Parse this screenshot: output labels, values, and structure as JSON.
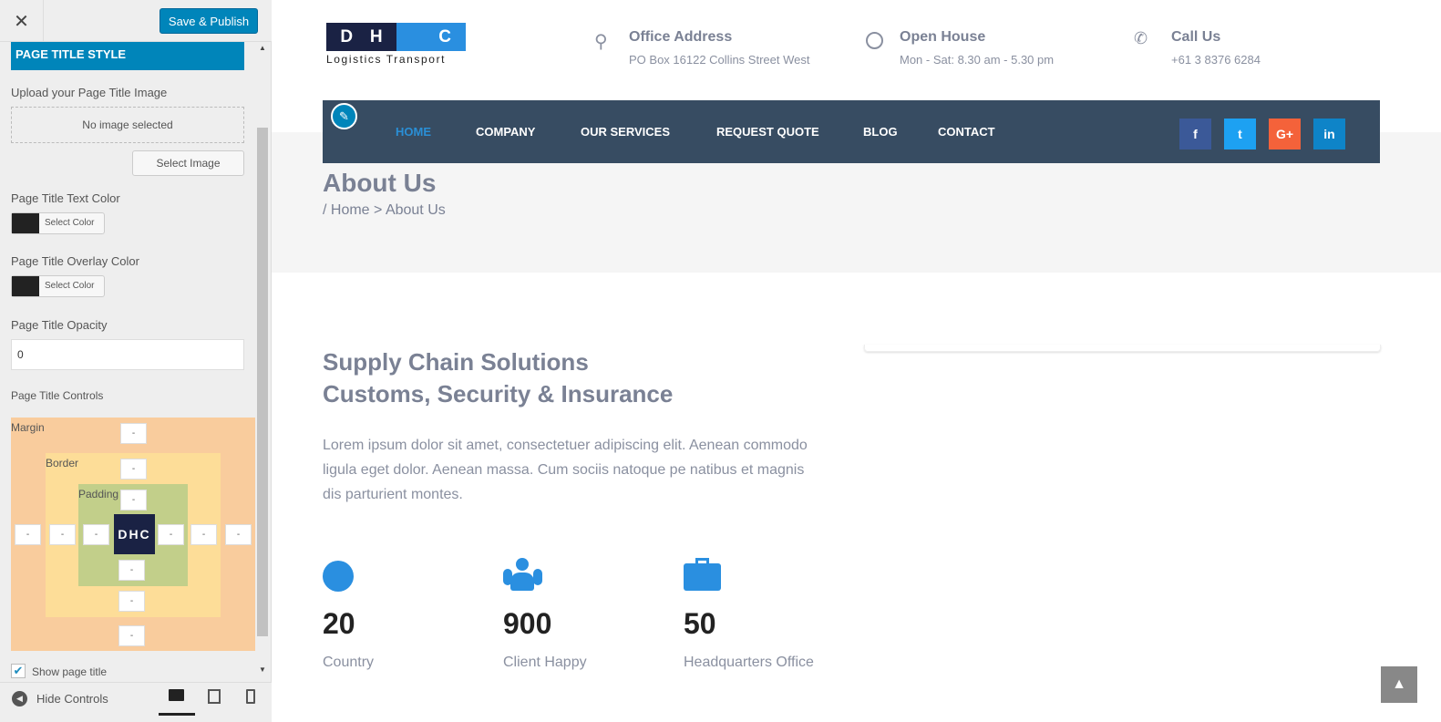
{
  "sidebar": {
    "close": "✕",
    "publish": "Save & Publish",
    "section": "PAGE TITLE STYLE",
    "upload_label": "Upload your Page Title Image",
    "no_image": "No image selected",
    "select_image": "Select Image",
    "text_color_label": "Page Title Text Color",
    "overlay_color_label": "Page Title Overlay Color",
    "select_color": "Select Color",
    "opacity_label": "Page Title Opacity",
    "opacity_value": "0",
    "controls_label": "Page Title Controls",
    "margin": "Margin",
    "border": "Border",
    "padding": "Padding",
    "dash": "-",
    "center_logo": "DHC",
    "show_title": "Show page title",
    "hide_controls": "Hide Controls",
    "swatch_color": "#222222"
  },
  "header": {
    "logo_letters": [
      "D",
      "H",
      "C"
    ],
    "logo_sub": "Logistics Transport",
    "info": [
      {
        "title": "Office Address",
        "sub": "PO Box 16122 Collins Street West",
        "icon": "map-pin-icon"
      },
      {
        "title": "Open House",
        "sub": "Mon - Sat: 8.30 am - 5.30 pm",
        "icon": "clock-icon"
      },
      {
        "title": "Call Us",
        "sub": "+61 3 8376 6284",
        "icon": "phone-icon"
      }
    ]
  },
  "nav": {
    "items": [
      "HOME",
      "COMPANY",
      "OUR SERVICES",
      "REQUEST QUOTE",
      "BLOG",
      "CONTACT"
    ],
    "social": [
      "f",
      "t",
      "G+",
      "in"
    ],
    "active_color": "#2a8fd6"
  },
  "page_title": {
    "title": "About Us",
    "crumb_home": "/ Home",
    "sep": ">",
    "crumb_current": "About Us"
  },
  "content": {
    "heading1": "Supply Chain Solutions",
    "heading2": "Customs, Security & Insurance",
    "body": "Lorem ipsum dolor sit amet, consectetuer adipiscing elit. Aenean commodo ligula eget dolor. Aenean massa. Cum sociis natoque pe natibus et magnis dis parturient montes.",
    "stats": [
      {
        "num": "20",
        "label": "Country",
        "icon": "globe-icon"
      },
      {
        "num": "900",
        "label": "Client Happy",
        "icon": "users-icon"
      },
      {
        "num": "50",
        "label": "Headquarters Office",
        "icon": "briefcase-icon"
      }
    ]
  }
}
